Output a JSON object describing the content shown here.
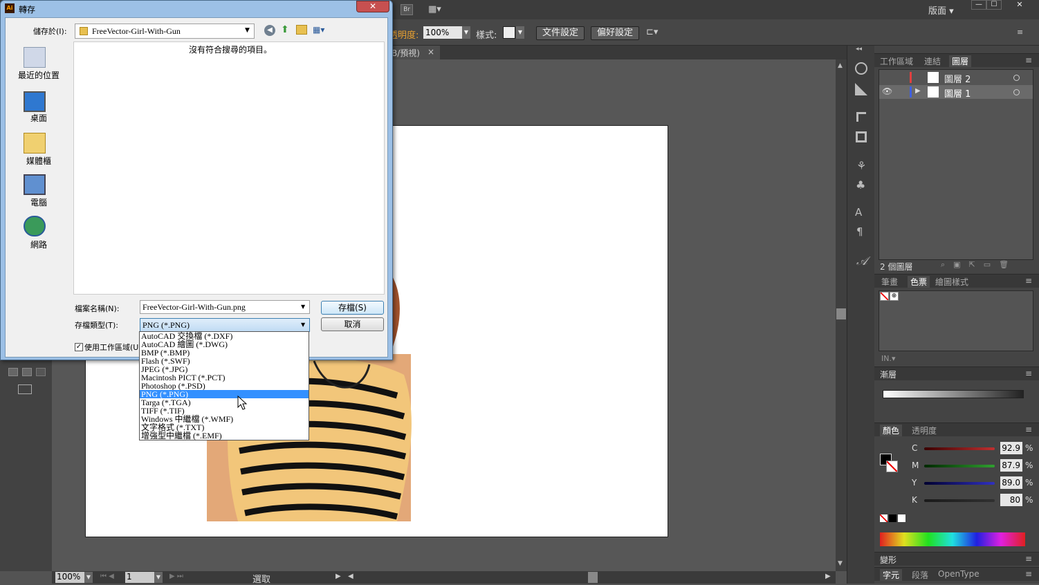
{
  "app": {
    "menu_right": "版面 ▾",
    "win_min": "—",
    "win_max": "☐",
    "win_close": "✕"
  },
  "control_bar": {
    "opacity_label": "透明度:",
    "opacity_value": "100%",
    "style_label": "樣式:",
    "doc_settings": "文件設定",
    "preferences": "偏好設定"
  },
  "doc_tab": {
    "label": "B/預視)",
    "close": "×"
  },
  "status_bar": {
    "zoom": "100%",
    "page": "1",
    "tool": "選取"
  },
  "layers_panel": {
    "tabs": [
      "工作區域",
      "連結",
      "圖層"
    ],
    "layers": [
      {
        "name": "圖層 2",
        "color": "#e04040"
      },
      {
        "name": "圖層 1",
        "color": "#4060e0"
      }
    ],
    "count": "2 個圖層"
  },
  "swatches_panel": {
    "tabs": [
      "筆畫",
      "色票",
      "繪圖樣式"
    ]
  },
  "gradient_panel": {
    "title": "漸層"
  },
  "color_panel": {
    "tabs": [
      "顏色",
      "透明度"
    ],
    "channels": [
      {
        "label": "C",
        "value": "92.9",
        "unit": "%",
        "color": "#c03030"
      },
      {
        "label": "M",
        "value": "87.9",
        "unit": "%",
        "color": "#30a030"
      },
      {
        "label": "Y",
        "value": "89.0",
        "unit": "%",
        "color": "#3030c0"
      },
      {
        "label": "K",
        "value": "80",
        "unit": "%",
        "color": "#303030"
      }
    ]
  },
  "transform_panel": {
    "title": "變形"
  },
  "char_panel": {
    "tabs": [
      "字元",
      "段落",
      "OpenType"
    ]
  },
  "dialog": {
    "title": "轉存",
    "save_in_label": "儲存於(I):",
    "save_in_value": "FreeVector-Girl-With-Gun",
    "empty_message": "沒有符合搜尋的項目。",
    "places": [
      "最近的位置",
      "桌面",
      "媒體櫃",
      "電腦",
      "網路"
    ],
    "filename_label": "檔案名稱(N):",
    "filename_value": "FreeVector-Girl-With-Gun.png",
    "filetype_label": "存檔類型(T):",
    "filetype_value": "PNG (*.PNG)",
    "save_button": "存檔(S)",
    "cancel_button": "取消",
    "use_artboard": "使用工作區域(U)",
    "filetypes": [
      "AutoCAD 交換檔 (*.DXF)",
      "AutoCAD 繪圖 (*.DWG)",
      "BMP (*.BMP)",
      "Flash (*.SWF)",
      "JPEG (*.JPG)",
      "Macintosh PICT (*.PCT)",
      "Photoshop (*.PSD)",
      "PNG (*.PNG)",
      "Targa (*.TGA)",
      "TIFF (*.TIF)",
      "Windows 中繼檔 (*.WMF)",
      "文字格式 (*.TXT)",
      "增強型中繼檔 (*.EMF)"
    ],
    "selected_filetype_index": 7
  }
}
